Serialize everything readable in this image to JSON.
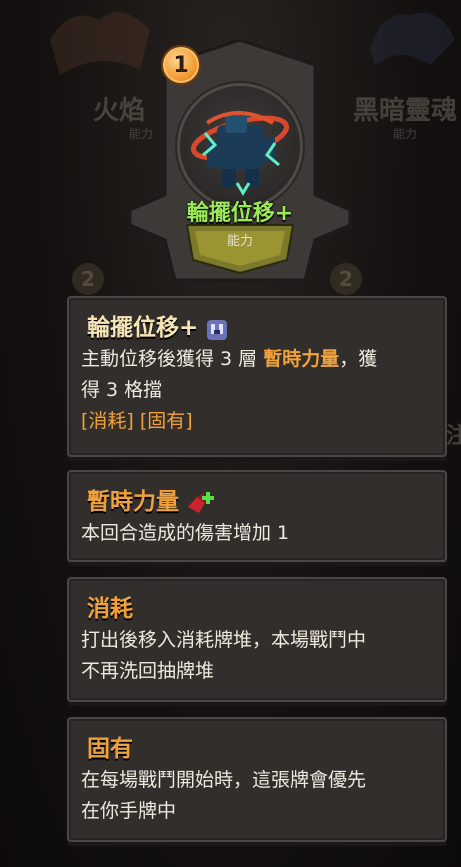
{
  "background": {
    "left_card_name": "火焰",
    "left_card_type": "能力",
    "right_card_name": "黑暗靈魂",
    "right_card_type": "能力",
    "left_cost": "2",
    "right_cost": "2",
    "edge_glyph": "注"
  },
  "card": {
    "cost": "1",
    "name": "輪擺位移+",
    "type": "能力",
    "art_icon": "pendulum-shift-art-icon"
  },
  "tooltips": [
    {
      "title": "輪擺位移+",
      "title_icon": "character-class-icon",
      "line1_pre": "主動位移後獲得 3 層 ",
      "line1_kw": "暫時力量",
      "line1_post": "，獲",
      "line2": "得 3 格擋",
      "tags": "[消耗] [固有]"
    },
    {
      "title": "暫時力量",
      "title_icon": "temporary-strength-icon",
      "line1": "本回合造成的傷害增加 1"
    },
    {
      "title": "消耗",
      "line1": "打出後移入消耗牌堆，本場戰鬥中",
      "line2": "不再洗回抽牌堆"
    },
    {
      "title": "固有",
      "line1": "在每場戰鬥開始時，這張牌會優先",
      "line2": "在你手牌中"
    }
  ],
  "colors": {
    "card_name": "#9bea56",
    "keyword": "#f3a23b",
    "title": "#f6e5b5",
    "panel_bg": "#312e2c"
  }
}
